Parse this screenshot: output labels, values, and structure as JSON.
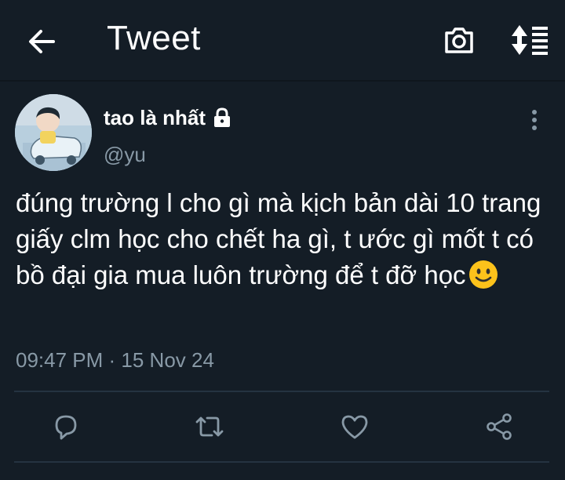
{
  "header": {
    "title": "Tweet",
    "back_icon": "arrow-left-icon",
    "camera_icon": "camera-icon",
    "sort_icon": "sort-icon"
  },
  "tweet": {
    "author": {
      "display_name": "tao là nhất",
      "handle": "@yu",
      "protected_icon": "lock-icon",
      "avatar": "avatar"
    },
    "text": "đúng trường l cho gì mà kịch bản dài 10 trang giấy clm học cho chết ha gì, t ước gì mốt t có bồ đại gia mua luôn trường để t đỡ học",
    "emoji": "smiling-face-emoji",
    "timestamp": "09:47 PM · 15 Nov 24",
    "actions": [
      "reply-icon",
      "retweet-icon",
      "like-icon",
      "share-icon"
    ]
  },
  "colors": {
    "background": "#141d26",
    "text": "#ffffff",
    "secondary_text": "#8899a6",
    "divider": "#253341",
    "icon": "#8899a6"
  }
}
